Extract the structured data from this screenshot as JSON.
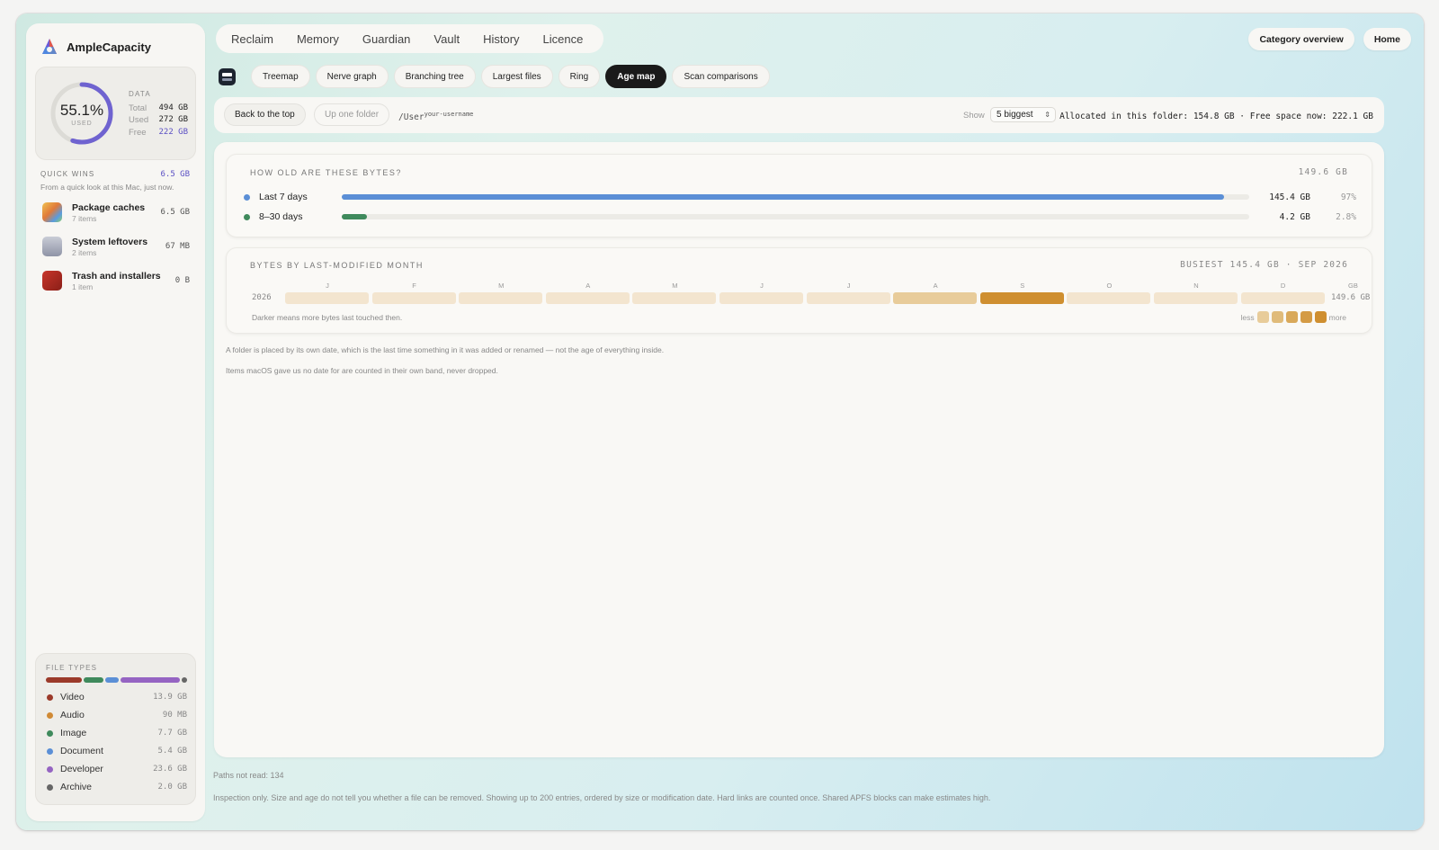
{
  "app": {
    "name": "AmpleCapacity"
  },
  "usage": {
    "percent": "55.1%",
    "percent_value": 0.551,
    "used_caption": "USED",
    "data_label": "DATA",
    "rows": [
      {
        "label": "Total",
        "value": "494 GB"
      },
      {
        "label": "Used",
        "value": "272 GB"
      },
      {
        "label": "Free",
        "value": "222 GB"
      }
    ]
  },
  "quick_wins": {
    "label": "QUICK WINS",
    "total": "6.5 GB",
    "subtitle": "From a quick look at this Mac, just now.",
    "items": [
      {
        "title": "Package caches",
        "count": "7 items",
        "size": "6.5 GB",
        "icon": "package-icon"
      },
      {
        "title": "System leftovers",
        "count": "2 items",
        "size": "67 MB",
        "icon": "drive-icon"
      },
      {
        "title": "Trash and installers",
        "count": "1 item",
        "size": "0 B",
        "icon": "trash-icon"
      }
    ]
  },
  "file_types": {
    "label": "FILE TYPES",
    "items": [
      {
        "name": "Video",
        "size": "13.9 GB",
        "color": "#9b3a2a"
      },
      {
        "name": "Audio",
        "size": "90 MB",
        "color": "#d08a35"
      },
      {
        "name": "Image",
        "size": "7.7 GB",
        "color": "#3f8a5c"
      },
      {
        "name": "Document",
        "size": "5.4 GB",
        "color": "#5b8fd6"
      },
      {
        "name": "Developer",
        "size": "23.6 GB",
        "color": "#9564c2"
      },
      {
        "name": "Archive",
        "size": "2.0 GB",
        "color": "#666666"
      }
    ]
  },
  "nav": {
    "items": [
      "Reclaim",
      "Memory",
      "Guardian",
      "Vault",
      "History",
      "Licence"
    ],
    "category_overview": "Category overview",
    "home": "Home"
  },
  "views": {
    "tabs": [
      "Treemap",
      "Nerve graph",
      "Branching tree",
      "Largest files",
      "Ring",
      "Age map",
      "Scan comparisons"
    ],
    "active": "Age map"
  },
  "pathbar": {
    "back_top": "Back to the top",
    "up_folder": "Up one folder",
    "path": "/User",
    "path_sup": "your-username",
    "show_label": "Show",
    "show_value": "5 biggest",
    "allocated": "Allocated in this folder: 154.8 GB · Free space now: 222.1 GB"
  },
  "age_card": {
    "title": "HOW OLD ARE THESE BYTES?",
    "total": "149.6 GB",
    "rows": [
      {
        "label": "Last 7 days",
        "size": "145.4 GB",
        "pct": "97%",
        "fraction": 0.972,
        "color": "#5b8fd6"
      },
      {
        "label": "8–30 days",
        "size": "4.2 GB",
        "pct": "2.8%",
        "fraction": 0.028,
        "color": "#3f8a5c"
      }
    ]
  },
  "month_card": {
    "title": "BYTES BY LAST-MODIFIED MONTH",
    "busiest": "BUSIEST 145.4 GB · SEP 2026",
    "year": "2026",
    "unit": "GB",
    "total": "149.6 GB",
    "months": [
      "J",
      "F",
      "M",
      "A",
      "M",
      "J",
      "J",
      "A",
      "S",
      "O",
      "N",
      "D"
    ],
    "levels": [
      0,
      0,
      0,
      0,
      0,
      0,
      0,
      2,
      5,
      0,
      0,
      0
    ],
    "note": "Darker means more bytes last touched then.",
    "less": "less",
    "more": "more",
    "scale_colors": [
      "#f3e5cf",
      "#e8cc9a",
      "#e0bb7a",
      "#d9a95a",
      "#cf8f30",
      "#c98a2d"
    ]
  },
  "notes": [
    "A folder is placed by its own date, which is the last time something in it was added or renamed — not the age of everything inside.",
    "Items macOS gave us no date for are counted in their own band, never dropped."
  ],
  "footer": {
    "paths_not_read": "Paths not read: 134",
    "disclaimer": "Inspection only. Size and age do not tell you whether a file can be removed. Showing up to 200 entries, ordered by size or modification date. Hard links are counted once. Shared APFS blocks can make estimates high."
  }
}
